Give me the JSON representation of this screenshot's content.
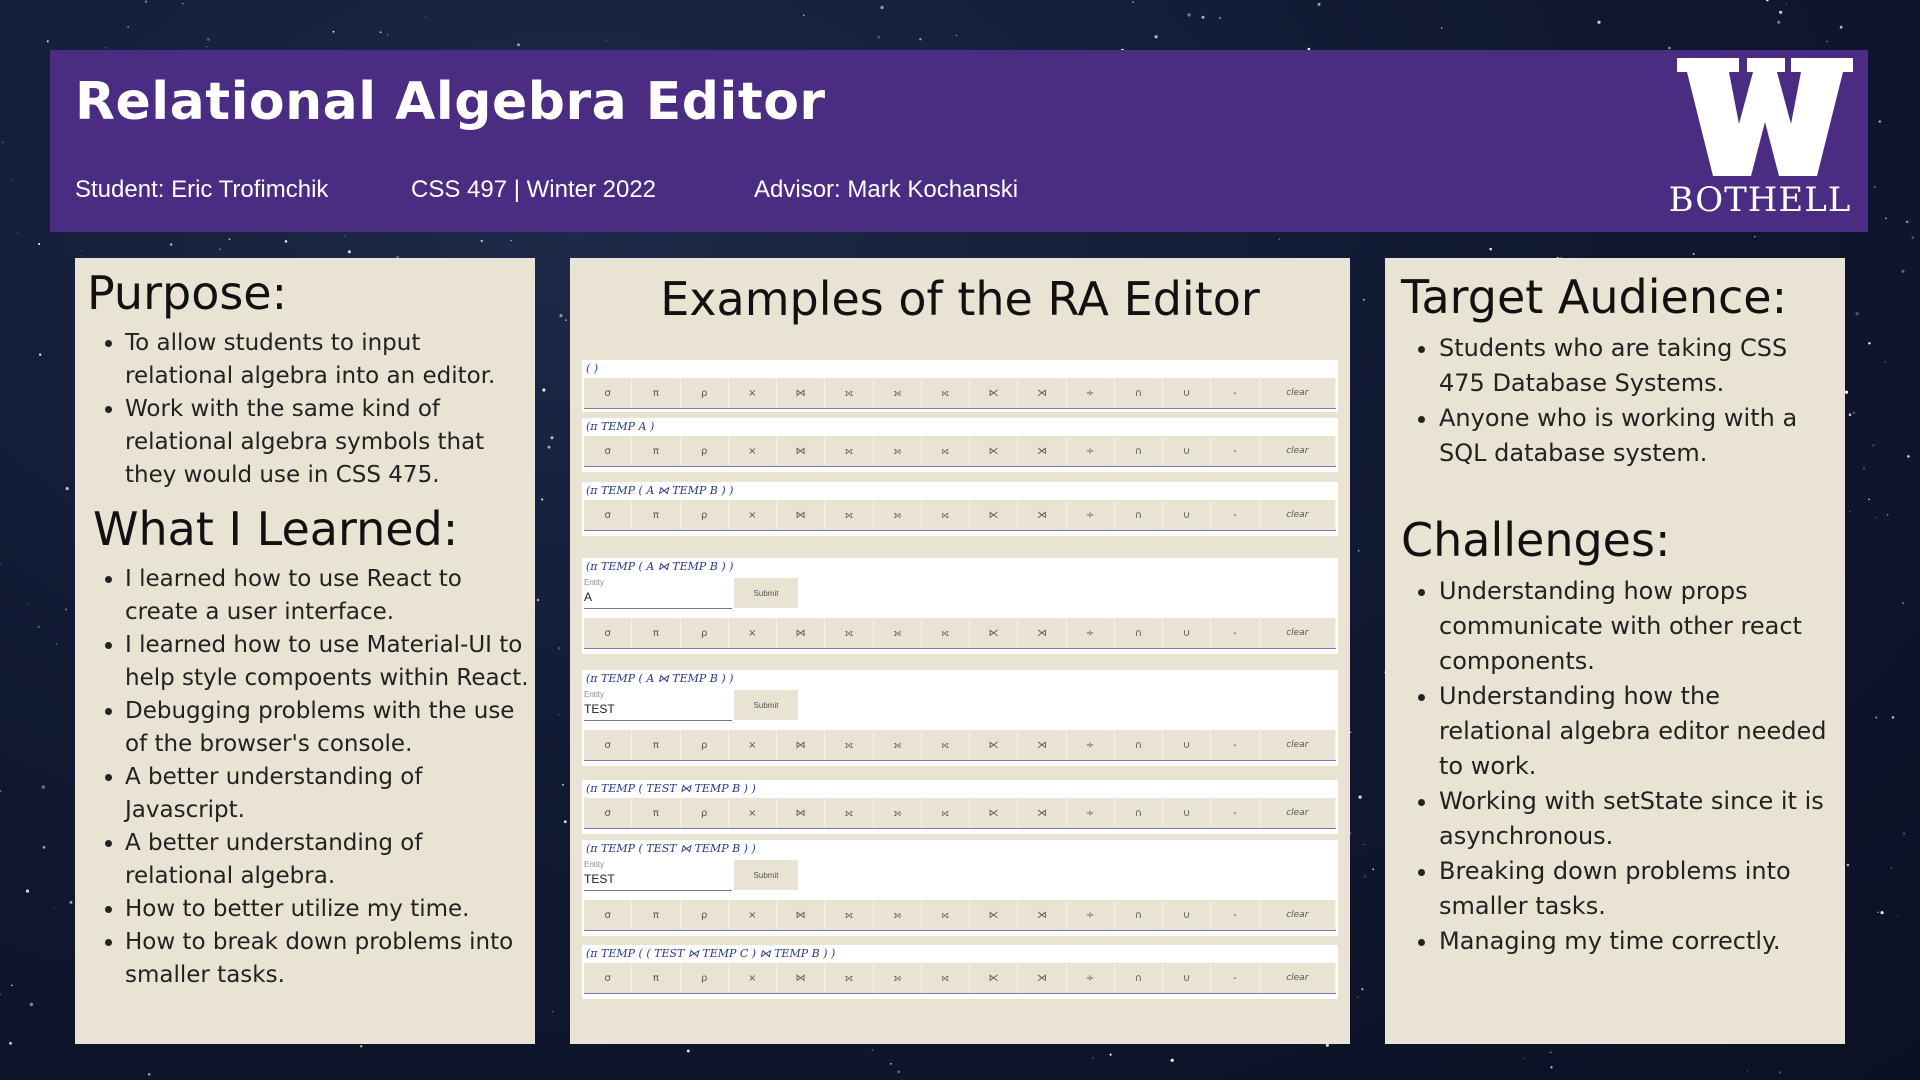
{
  "header": {
    "title": "Relational Algebra Editor",
    "student": "Student: Eric Trofimchik",
    "course": "CSS 497 | Winter 2022",
    "advisor": "Advisor: Mark Kochanski",
    "logo_letter": "W",
    "logo_text": "BOTHELL"
  },
  "colors": {
    "header_bg": "#4b2c83",
    "panel_bg": "#e8e3d3",
    "background": "#111a33"
  },
  "purpose": {
    "heading": "Purpose:",
    "items": [
      "To allow students to input relational algebra into an editor.",
      "Work with the same kind of relational algebra symbols that they would use in  CSS 475."
    ]
  },
  "learned": {
    "heading": "What I Learned:",
    "items": [
      "I learned how to use React to create a user interface.",
      "I learned how to use Material-UI to help style compoents within React.",
      "Debugging problems with the use of the browser's console.",
      "A better understanding of Javascript.",
      "A better understanding of relational algebra.",
      "How to better utilize my time.",
      "How to break down problems into smaller tasks."
    ]
  },
  "examples": {
    "heading": "Examples of the RA Editor",
    "operators": [
      "σ",
      "π",
      "ρ",
      "×",
      "⋈",
      "⟗",
      "⟕",
      "⟖",
      "⋉",
      "⋊",
      "÷",
      "∩",
      "∪",
      "-",
      "clear"
    ],
    "entity_label": "Entity",
    "submit_label": "Submit",
    "shots": [
      {
        "expr": "(   )"
      },
      {
        "expr": "(π TEMP  A  )"
      },
      {
        "expr": "(π TEMP (  A  ⋈ TEMP  B  ) )"
      },
      {
        "expr": "(π TEMP (  A  ⋈ TEMP  B  ) )",
        "entity_value": "A"
      },
      {
        "expr": "(π TEMP (  A  ⋈ TEMP  B  ) )",
        "entity_value": "TEST"
      },
      {
        "expr": "(π TEMP (  TEST  ⋈ TEMP  B  ) )"
      },
      {
        "expr": "(π TEMP (  TEST  ⋈ TEMP  B  ) )",
        "entity_value": "TEST"
      },
      {
        "expr": "(π TEMP ( (  TEST  ⋈ TEMP  C  ) ⋈ TEMP  B  ) )"
      }
    ]
  },
  "audience": {
    "heading": "Target Audience:",
    "items": [
      "Students who are taking CSS 475 Database Systems.",
      "Anyone who is working with a SQL database system."
    ]
  },
  "challenges": {
    "heading": "Challenges:",
    "items": [
      "Understanding how props communicate with other react components.",
      "Understanding how the relational algebra editor needed to work.",
      "Working with setState since it is asynchronous.",
      "Breaking down problems into smaller tasks.",
      "Managing my time correctly."
    ]
  }
}
